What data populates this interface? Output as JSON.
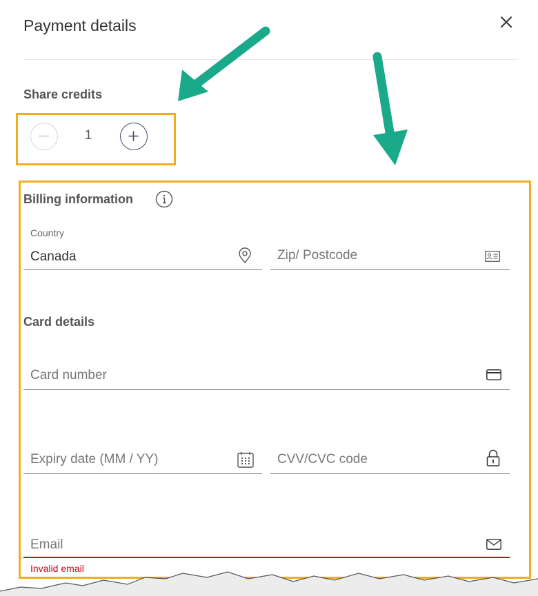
{
  "header": {
    "title": "Payment details"
  },
  "share_credits": {
    "label": "Share credits",
    "value": "1"
  },
  "billing": {
    "heading": "Billing information",
    "country_label": "Country",
    "country_value": "Canada",
    "zip_placeholder": "Zip/ Postcode"
  },
  "card": {
    "heading": "Card details",
    "number_placeholder": "Card number",
    "expiry_placeholder": "Expiry date (MM / YY)",
    "cvv_placeholder": "CVV/CVC code"
  },
  "email": {
    "placeholder": "Email",
    "error": "Invalid email"
  },
  "colors": {
    "annotation_arrow": "#1aaa8a",
    "highlight_box": "#f2ac1d",
    "error": "#d0021b",
    "accent": "#3d4a6b"
  },
  "icons": [
    "close-icon",
    "minus-icon",
    "plus-icon",
    "info-icon",
    "location-pin-icon",
    "id-card-icon",
    "credit-card-icon",
    "calendar-icon",
    "lock-icon",
    "envelope-icon"
  ]
}
